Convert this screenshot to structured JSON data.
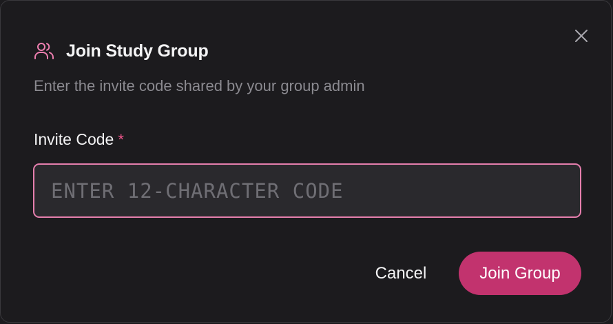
{
  "dialog": {
    "title": "Join Study Group",
    "subtitle": "Enter the invite code shared by your group admin",
    "title_icon": "users-icon",
    "close_icon": "close-icon"
  },
  "form": {
    "invite_label": "Invite Code",
    "required_mark": "*",
    "invite_placeholder": "ENTER 12-CHARACTER CODE",
    "invite_value": ""
  },
  "actions": {
    "cancel_label": "Cancel",
    "join_label": "Join Group"
  },
  "colors": {
    "background": "#1c1b1e",
    "accent": "#c2336e",
    "input_border": "#e67fae",
    "icon": "#ef7fb0",
    "required": "#f0568c",
    "muted_text": "#8b8a90"
  }
}
